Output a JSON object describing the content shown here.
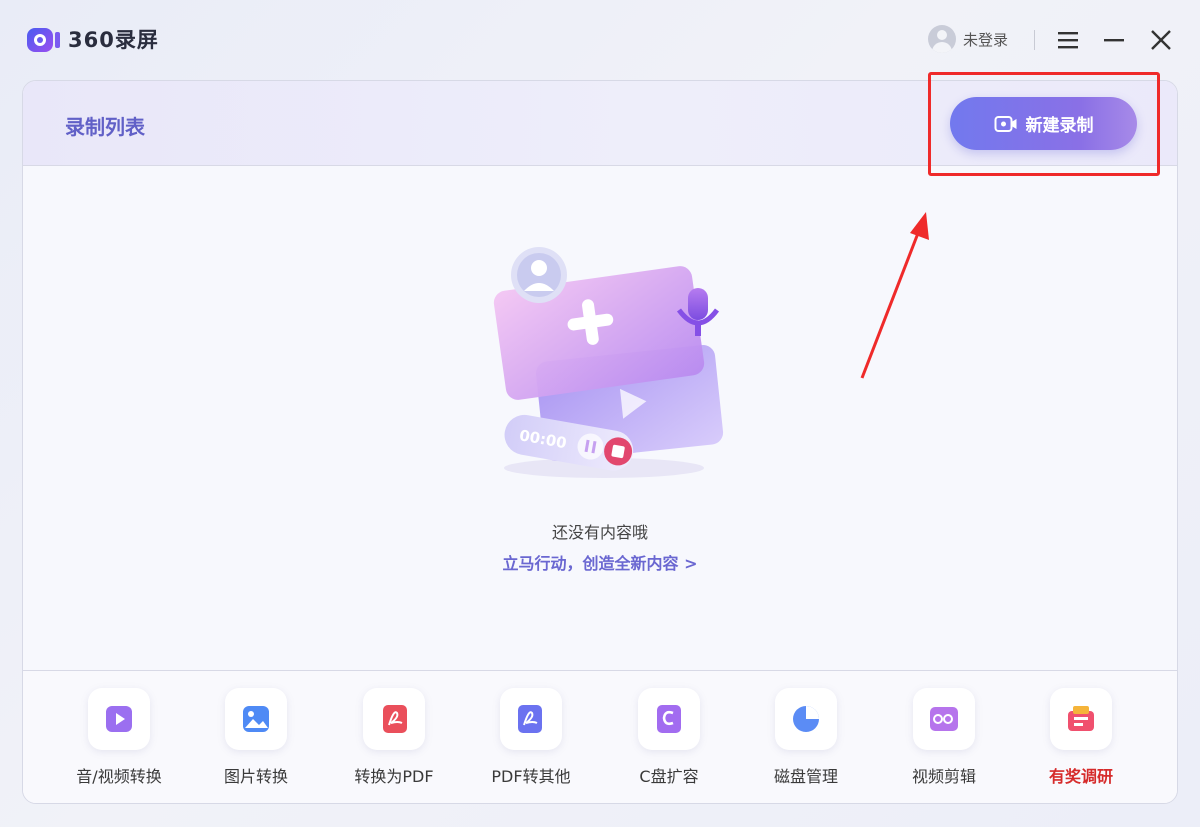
{
  "app": {
    "name": "360录屏"
  },
  "titlebar": {
    "user_label": "未登录"
  },
  "panel": {
    "title": "录制列表",
    "new_record_label": "新建录制",
    "empty_text": "还没有内容哦",
    "empty_action": "立马行动，创造全新内容 >",
    "timer": "00:00"
  },
  "tools": [
    {
      "label": "音/视频转换",
      "icon": "media-convert-icon"
    },
    {
      "label": "图片转换",
      "icon": "image-convert-icon"
    },
    {
      "label": "转换为PDF",
      "icon": "to-pdf-icon"
    },
    {
      "label": "PDF转其他",
      "icon": "pdf-convert-icon"
    },
    {
      "label": "C盘扩容",
      "icon": "c-drive-icon"
    },
    {
      "label": "磁盘管理",
      "icon": "disk-manage-icon"
    },
    {
      "label": "视频剪辑",
      "icon": "video-edit-icon"
    },
    {
      "label": "有奖调研",
      "icon": "survey-icon",
      "color": "#d62b2b"
    }
  ],
  "colors": {
    "accent": "#6a67d1",
    "button_gradient_start": "#7279ee",
    "button_gradient_end": "#a78ae8",
    "annotation": "#ef2a2a"
  }
}
